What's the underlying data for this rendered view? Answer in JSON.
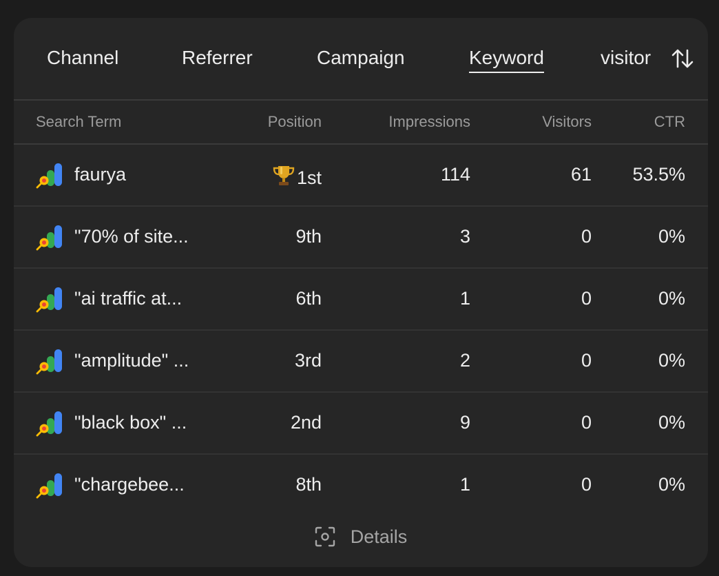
{
  "tabs": [
    {
      "label": "Channel"
    },
    {
      "label": "Referrer"
    },
    {
      "label": "Campaign"
    },
    {
      "label": "Keyword",
      "active": true
    },
    {
      "label": "visitor"
    }
  ],
  "sort_icon": "sort-arrows-icon",
  "table": {
    "headers": {
      "term": "Search Term",
      "position": "Position",
      "impressions": "Impressions",
      "visitors": "Visitors",
      "ctr": "CTR"
    },
    "rows": [
      {
        "icon": "google-search-console-icon",
        "term": "faurya",
        "position_badge": "trophy-icon",
        "position": "1st",
        "impressions": "114",
        "visitors": "61",
        "ctr": "53.5%"
      },
      {
        "icon": "google-search-console-icon",
        "term": "\"70% of site...",
        "position": "9th",
        "impressions": "3",
        "visitors": "0",
        "ctr": "0%"
      },
      {
        "icon": "google-search-console-icon",
        "term": "\"ai traffic at...",
        "position": "6th",
        "impressions": "1",
        "visitors": "0",
        "ctr": "0%"
      },
      {
        "icon": "google-search-console-icon",
        "term": "\"amplitude\" ...",
        "position": "3rd",
        "impressions": "2",
        "visitors": "0",
        "ctr": "0%"
      },
      {
        "icon": "google-search-console-icon",
        "term": "\"black box\" ...",
        "position": "2nd",
        "impressions": "9",
        "visitors": "0",
        "ctr": "0%"
      },
      {
        "icon": "google-search-console-icon",
        "term": "\"chargebee...",
        "position": "8th",
        "impressions": "1",
        "visitors": "0",
        "ctr": "0%"
      }
    ]
  },
  "details": {
    "icon": "focus-scan-icon",
    "label": "Details"
  }
}
